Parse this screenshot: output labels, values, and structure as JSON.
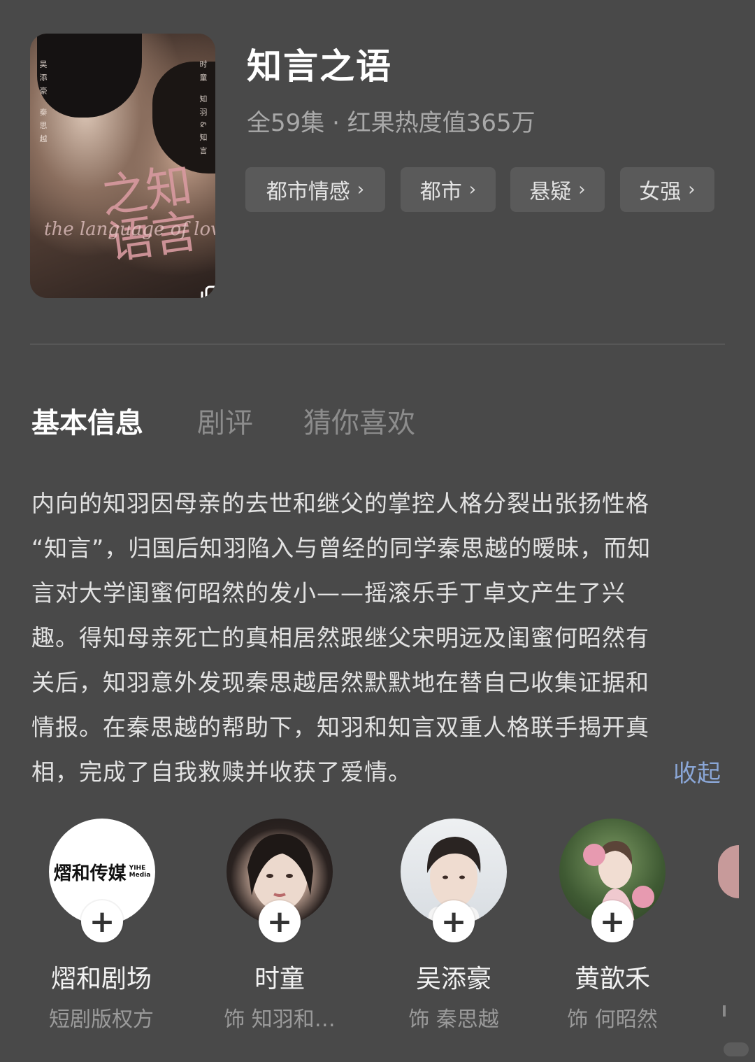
{
  "drama": {
    "title": "知言之语",
    "meta": "全59集 · 红果热度值365万",
    "poster": {
      "calligraphy": "知言之语",
      "script": "the language of love",
      "left_vertical": "吴添豪 秦思越",
      "right_vertical": "时童 知羽&知言"
    }
  },
  "tags": [
    {
      "label": "都市情感",
      "chevron": "›"
    },
    {
      "label": "都市",
      "chevron": "›"
    },
    {
      "label": "悬疑",
      "chevron": "›"
    },
    {
      "label": "女强",
      "chevron": "›"
    }
  ],
  "tabs": [
    {
      "label": "基本信息",
      "active": true
    },
    {
      "label": "剧评",
      "active": false
    },
    {
      "label": "猜你喜欢",
      "active": false
    }
  ],
  "description": {
    "lines": [
      "内向的知羽因母亲的去世和继父的掌控人格分裂出张扬性格",
      "“知言”，归国后知羽陷入与曾经的同学秦思越的暧昧，而知",
      "言对大学闺蜜何昭然的发小——摇滚乐手丁卓文产生了兴",
      "趣。得知母亲死亡的真相居然跟继父宋明远及闺蜜何昭然有",
      "关后，知羽意外发现秦思越居然默默地在替自己收集证据和",
      "情报。在秦思越的帮助下，知羽和知言双重人格联手揭开真",
      "相，完成了自我救赎并收获了爱情。"
    ],
    "collapse_label": "收起"
  },
  "cast": [
    {
      "name": "熠和剧场",
      "role": "短剧版权方",
      "logo_text": "熠和传媒",
      "logo_sub_1": "YIHE",
      "logo_sub_2": "Media",
      "plus": "+"
    },
    {
      "name": "时童",
      "role": "饰 知羽和…",
      "plus": "+"
    },
    {
      "name": "吴添豪",
      "role": "饰 秦思越",
      "plus": "+"
    },
    {
      "name": "黄歆禾",
      "role": "饰 何昭然",
      "plus": "+"
    }
  ],
  "colors": {
    "background": "#494949",
    "tag_bg": "#5a5a5a",
    "link": "#8aa6d6"
  }
}
